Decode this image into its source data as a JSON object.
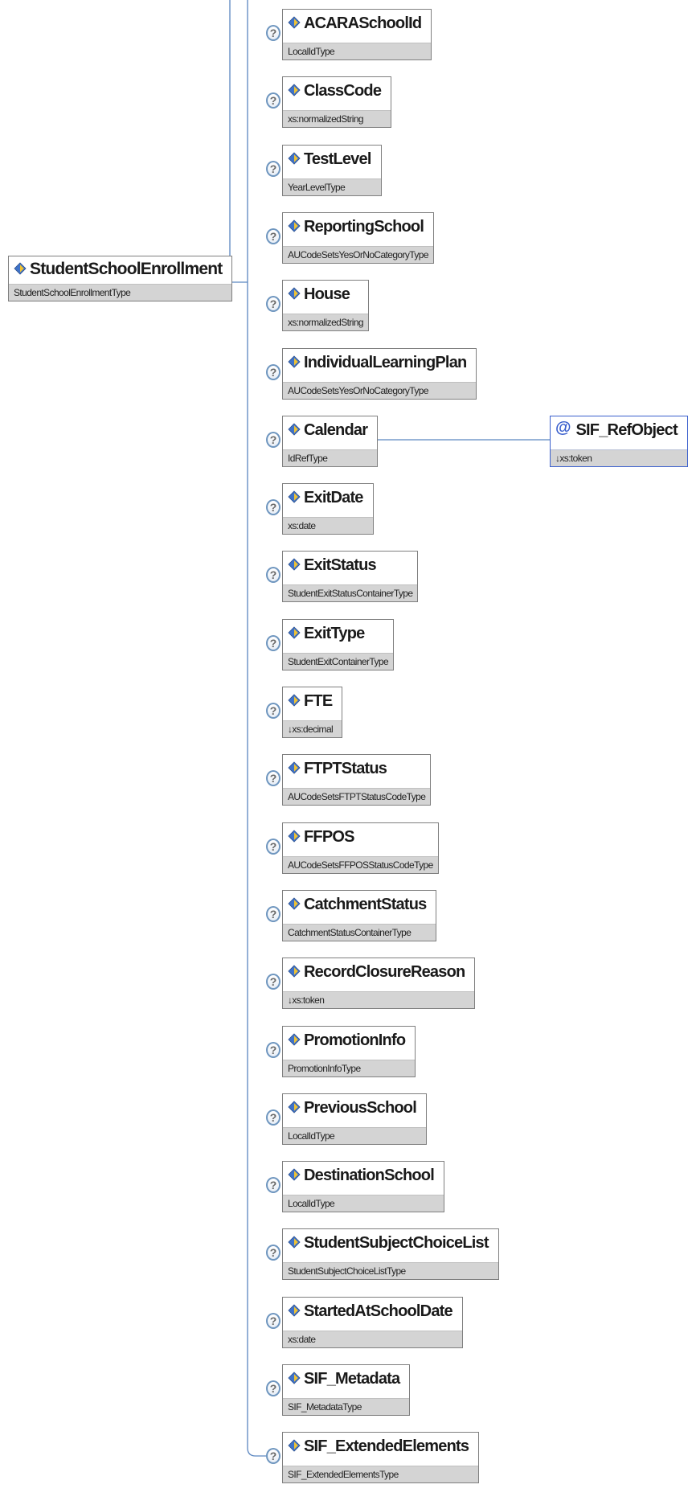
{
  "diagram": {
    "root": {
      "name": "StudentSchoolEnrollment",
      "type": "StudentSchoolEnrollmentType"
    },
    "help_glyph": "?",
    "attribute_glyph": "@",
    "colors": {
      "line": "#5a86c0",
      "box_border": "#7f7f7f",
      "type_band": "#d4d4d4",
      "ref_border": "#3a5fcd"
    },
    "children": [
      {
        "name": "ACARASchoolId",
        "type": "LocalIdType"
      },
      {
        "name": "ClassCode",
        "type": "xs:normalizedString"
      },
      {
        "name": "TestLevel",
        "type": "YearLevelType"
      },
      {
        "name": "ReportingSchool",
        "type": "AUCodeSetsYesOrNoCategoryType"
      },
      {
        "name": "House",
        "type": "xs:normalizedString"
      },
      {
        "name": "IndividualLearningPlan",
        "type": "AUCodeSetsYesOrNoCategoryType"
      },
      {
        "name": "Calendar",
        "type": "IdRefType"
      },
      {
        "name": "ExitDate",
        "type": "xs:date"
      },
      {
        "name": "ExitStatus",
        "type": "StudentExitStatusContainerType"
      },
      {
        "name": "ExitType",
        "type": "StudentExitContainerType"
      },
      {
        "name": "FTE",
        "type": "↓xs:decimal"
      },
      {
        "name": "FTPTStatus",
        "type": "AUCodeSetsFTPTStatusCodeType"
      },
      {
        "name": "FFPOS",
        "type": "AUCodeSetsFFPOSStatusCodeType"
      },
      {
        "name": "CatchmentStatus",
        "type": "CatchmentStatusContainerType"
      },
      {
        "name": "RecordClosureReason",
        "type": "↓xs:token"
      },
      {
        "name": "PromotionInfo",
        "type": "PromotionInfoType"
      },
      {
        "name": "PreviousSchool",
        "type": "LocalIdType"
      },
      {
        "name": "DestinationSchool",
        "type": "LocalIdType"
      },
      {
        "name": "StudentSubjectChoiceList",
        "type": "StudentSubjectChoiceListType"
      },
      {
        "name": "StartedAtSchoolDate",
        "type": "xs:date"
      },
      {
        "name": "SIF_Metadata",
        "type": "SIF_MetadataType"
      },
      {
        "name": "SIF_ExtendedElements",
        "type": "SIF_ExtendedElementsType"
      }
    ],
    "calendar_attribute": {
      "name": "SIF_RefObject",
      "type": "↓xs:token"
    }
  }
}
